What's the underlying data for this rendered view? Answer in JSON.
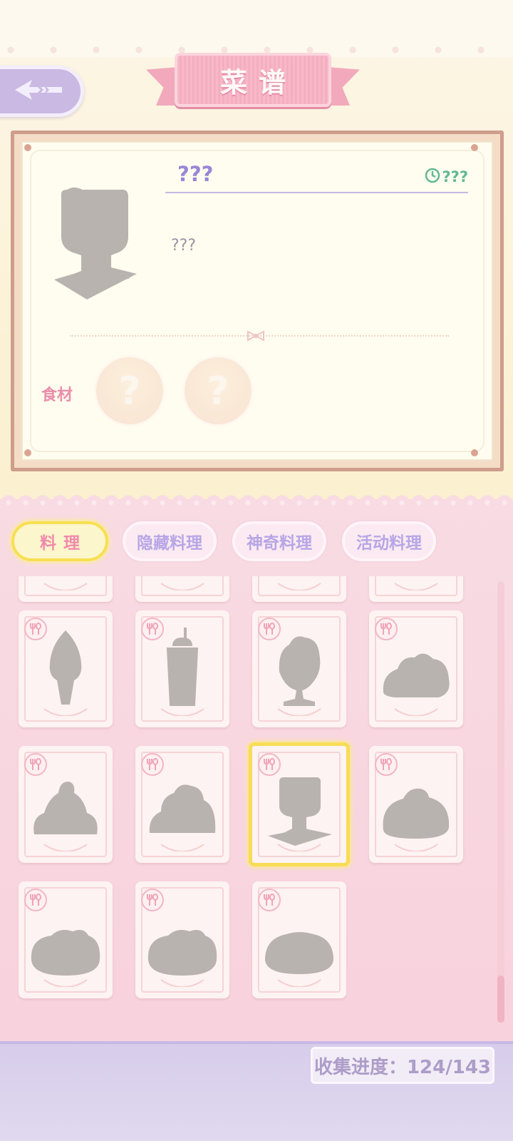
{
  "header": {
    "title": "菜谱",
    "back_icon": "back-arrow-icon"
  },
  "detail": {
    "dish_name": "???",
    "time_icon": "clock-icon",
    "time_value": "???",
    "description": "???",
    "ingredients_label": "食材",
    "ingredients": [
      "?",
      "?"
    ]
  },
  "tabs": [
    {
      "label": "料理",
      "active": true
    },
    {
      "label": "隐藏料理",
      "active": false
    },
    {
      "label": "神奇料理",
      "active": false
    },
    {
      "label": "活动料理",
      "active": false
    }
  ],
  "grid": {
    "badge_icon": "fork-spoon-icon",
    "items": [
      {
        "silhouette": "partial",
        "selected": false
      },
      {
        "silhouette": "partial",
        "selected": false
      },
      {
        "silhouette": "partial",
        "selected": false
      },
      {
        "silhouette": "partial",
        "selected": false
      },
      {
        "silhouette": "ice-cream-cone",
        "selected": false
      },
      {
        "silhouette": "drink-cup",
        "selected": false
      },
      {
        "silhouette": "sundae-cup",
        "selected": false
      },
      {
        "silhouette": "rice-mound",
        "selected": false
      },
      {
        "silhouette": "garnished-pile",
        "selected": false
      },
      {
        "silhouette": "pile-dish",
        "selected": false
      },
      {
        "silhouette": "tall-glass-plate",
        "selected": true
      },
      {
        "silhouette": "dumpling",
        "selected": false
      },
      {
        "silhouette": "round-plate",
        "selected": false
      },
      {
        "silhouette": "round-plate",
        "selected": false
      },
      {
        "silhouette": "flat-plate",
        "selected": false
      }
    ]
  },
  "footer": {
    "progress_label": "收集进度：124/143",
    "collected": 124,
    "total": 143
  },
  "colors": {
    "silhouette": "#b8b3ae",
    "tab_text": "#b7a6e6",
    "active_tab_text": "#f08aad",
    "ingredient_label": "#e88eab",
    "time_color": "#62b894",
    "accent_pink": "#f4aec0"
  }
}
